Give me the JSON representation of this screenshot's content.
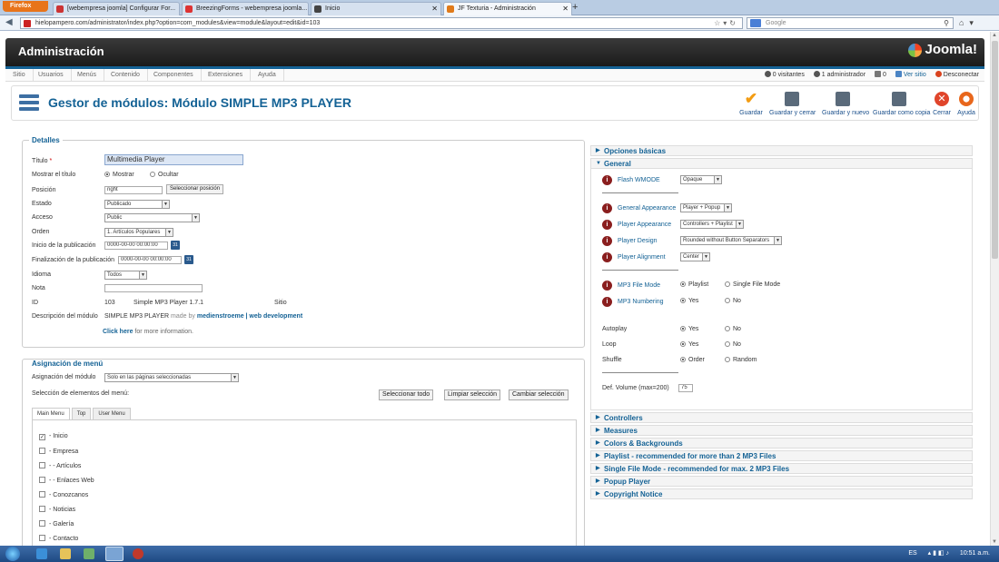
{
  "browser": {
    "button_label": "Firefox",
    "tabs": [
      {
        "label": "[webempresa joomla] Configurar For..."
      },
      {
        "label": "BreezingForms - webempresa joomla..."
      },
      {
        "label": "Inicio"
      },
      {
        "label": "JF Texturia - Administración"
      }
    ],
    "new_tab_label": "+",
    "url": "hielopampero.com/administrator/index.php?option=com_modules&view=module&layout=edit&id=103",
    "search_placeholder": "Google"
  },
  "admin": {
    "title": "Administración",
    "logo_text": "Joomla!",
    "menu": [
      "Sitio",
      "Usuarios",
      "Menús",
      "Contenido",
      "Componentes",
      "Extensiones",
      "Ayuda"
    ],
    "status": {
      "visitors": "0 visitantes",
      "admins": "1 administrador",
      "messages": "0",
      "view_site": "Ver sitio",
      "logout": "Desconectar"
    }
  },
  "toolbar": {
    "title": "Gestor de módulos: Módulo SIMPLE MP3 PLAYER",
    "buttons": [
      {
        "label": "Guardar",
        "icon": "check-icon"
      },
      {
        "label": "Guardar y cerrar",
        "icon": "save-close-icon"
      },
      {
        "label": "Guardar y nuevo",
        "icon": "save-new-icon"
      },
      {
        "label": "Guardar como copia",
        "icon": "save-copy-icon"
      },
      {
        "label": "Cerrar",
        "icon": "close-icon"
      },
      {
        "label": "Ayuda",
        "icon": "help-icon"
      }
    ]
  },
  "details": {
    "legend": "Detalles",
    "title_label": "Título",
    "required_mark": "*",
    "title_value": "Multimedia Player",
    "show_title_label": "Mostrar el título",
    "show_option": "Mostrar",
    "hide_option": "Ocultar",
    "position_label": "Posición",
    "position_value": "right",
    "select_position": "Seleccionar posición",
    "state_label": "Estado",
    "state_value": "Publicado",
    "access_label": "Acceso",
    "access_value": "Public",
    "order_label": "Orden",
    "order_value": "1. Artículos Populares",
    "publish_up_label": "Inicio de la publicación",
    "publish_up_value": "0000-00-00 00:00:00",
    "publish_down_label": "Finalización de la publicación",
    "publish_down_value": "0000-00-00 00:00:00",
    "language_label": "Idioma",
    "language_value": "Todos",
    "note_label": "Nota",
    "note_value": "",
    "id_label": "ID",
    "id_value": "103",
    "module_name": "Simple MP3 Player 1.7.1",
    "site_label": "Sitio",
    "description_label": "Descripción del módulo",
    "description_prefix": "SIMPLE MP3 PLAYER",
    "description_made_by": "made by",
    "description_link": "medienstroeme | web development",
    "click_here": "Click here",
    "more_info": "for more information.",
    "calendar_icon_text": "31"
  },
  "menu_assignment": {
    "legend": "Asignación de menú",
    "module_assignment_label": "Asignación del módulo",
    "module_assignment_value": "Solo en las páginas seleccionadas",
    "selection_label": "Selección de elementos del menú:",
    "buttons": [
      "Seleccionar todo",
      "Limpiar selección",
      "Cambiar selección"
    ],
    "tabs": [
      "Main Menu",
      "Top",
      "User Menu"
    ],
    "items": [
      {
        "label": "- Inicio",
        "checked": true
      },
      {
        "label": "- Empresa",
        "checked": false
      },
      {
        "label": "- - Artículos",
        "checked": false
      },
      {
        "label": "- - Enlaces Web",
        "checked": false
      },
      {
        "label": "- Conozcanos",
        "checked": false
      },
      {
        "label": "- Noticias",
        "checked": false
      },
      {
        "label": "- Galería",
        "checked": false
      },
      {
        "label": "- Contacto",
        "checked": false
      }
    ]
  },
  "options": {
    "basic": "Opciones básicas",
    "general": "General",
    "info_icon_text": "i",
    "flash_wmode_label": "Flash WMODE",
    "flash_wmode_value": "Opaque",
    "general_appearance_label": "General Appearance",
    "general_appearance_value": "Player + Popup",
    "player_appearance_label": "Player Appearance",
    "player_appearance_value": "Controllers + Playlist",
    "player_design_label": "Player Design",
    "player_design_value": "Rounded without Button Separators",
    "player_alignment_label": "Player Alignment",
    "player_alignment_value": "Center",
    "file_mode_label": "MP3 File Mode",
    "file_mode_playlist": "Playlist",
    "file_mode_single": "Single File Mode",
    "numbering_label": "MP3 Numbering",
    "yes": "Yes",
    "no": "No",
    "autoplay_label": "Autoplay",
    "loop_label": "Loop",
    "shuffle_label": "Shuffle",
    "shuffle_order": "Order",
    "shuffle_random": "Random",
    "volume_label": "Def. Volume (max=200)",
    "volume_value": "75",
    "sections": [
      {
        "label": "Controllers"
      },
      {
        "label": "Measures"
      },
      {
        "label": "Colors & Backgrounds"
      },
      {
        "label": "Playlist - recommended for more than 2 MP3 Files"
      },
      {
        "label": "Single File Mode - recommended for max. 2 MP3 Files"
      },
      {
        "label": "Popup Player"
      },
      {
        "label": "Copyright Notice"
      }
    ]
  },
  "taskbar": {
    "lang": "ES",
    "time": "10:51 a.m."
  },
  "colors": {
    "accent": "#146295",
    "header_bg": "#222222",
    "taskbar": "#2a5a95"
  }
}
